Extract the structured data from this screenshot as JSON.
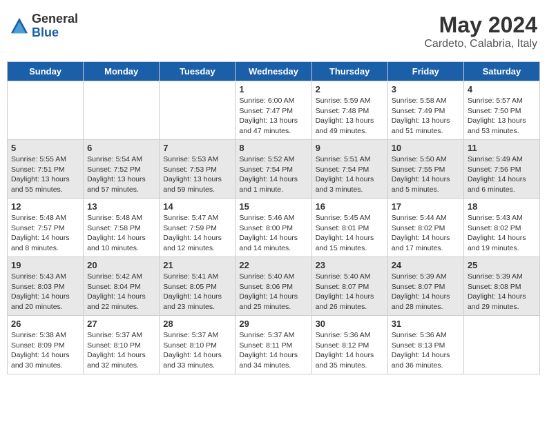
{
  "header": {
    "logo_general": "General",
    "logo_blue": "Blue",
    "title": "May 2024",
    "subtitle": "Cardeto, Calabria, Italy"
  },
  "days_of_week": [
    "Sunday",
    "Monday",
    "Tuesday",
    "Wednesday",
    "Thursday",
    "Friday",
    "Saturday"
  ],
  "weeks": [
    {
      "shade": false,
      "days": [
        {
          "num": "",
          "info": ""
        },
        {
          "num": "",
          "info": ""
        },
        {
          "num": "",
          "info": ""
        },
        {
          "num": "1",
          "info": "Sunrise: 6:00 AM\nSunset: 7:47 PM\nDaylight: 13 hours\nand 47 minutes."
        },
        {
          "num": "2",
          "info": "Sunrise: 5:59 AM\nSunset: 7:48 PM\nDaylight: 13 hours\nand 49 minutes."
        },
        {
          "num": "3",
          "info": "Sunrise: 5:58 AM\nSunset: 7:49 PM\nDaylight: 13 hours\nand 51 minutes."
        },
        {
          "num": "4",
          "info": "Sunrise: 5:57 AM\nSunset: 7:50 PM\nDaylight: 13 hours\nand 53 minutes."
        }
      ]
    },
    {
      "shade": true,
      "days": [
        {
          "num": "5",
          "info": "Sunrise: 5:55 AM\nSunset: 7:51 PM\nDaylight: 13 hours\nand 55 minutes."
        },
        {
          "num": "6",
          "info": "Sunrise: 5:54 AM\nSunset: 7:52 PM\nDaylight: 13 hours\nand 57 minutes."
        },
        {
          "num": "7",
          "info": "Sunrise: 5:53 AM\nSunset: 7:53 PM\nDaylight: 13 hours\nand 59 minutes."
        },
        {
          "num": "8",
          "info": "Sunrise: 5:52 AM\nSunset: 7:54 PM\nDaylight: 14 hours\nand 1 minute."
        },
        {
          "num": "9",
          "info": "Sunrise: 5:51 AM\nSunset: 7:54 PM\nDaylight: 14 hours\nand 3 minutes."
        },
        {
          "num": "10",
          "info": "Sunrise: 5:50 AM\nSunset: 7:55 PM\nDaylight: 14 hours\nand 5 minutes."
        },
        {
          "num": "11",
          "info": "Sunrise: 5:49 AM\nSunset: 7:56 PM\nDaylight: 14 hours\nand 6 minutes."
        }
      ]
    },
    {
      "shade": false,
      "days": [
        {
          "num": "12",
          "info": "Sunrise: 5:48 AM\nSunset: 7:57 PM\nDaylight: 14 hours\nand 8 minutes."
        },
        {
          "num": "13",
          "info": "Sunrise: 5:48 AM\nSunset: 7:58 PM\nDaylight: 14 hours\nand 10 minutes."
        },
        {
          "num": "14",
          "info": "Sunrise: 5:47 AM\nSunset: 7:59 PM\nDaylight: 14 hours\nand 12 minutes."
        },
        {
          "num": "15",
          "info": "Sunrise: 5:46 AM\nSunset: 8:00 PM\nDaylight: 14 hours\nand 14 minutes."
        },
        {
          "num": "16",
          "info": "Sunrise: 5:45 AM\nSunset: 8:01 PM\nDaylight: 14 hours\nand 15 minutes."
        },
        {
          "num": "17",
          "info": "Sunrise: 5:44 AM\nSunset: 8:02 PM\nDaylight: 14 hours\nand 17 minutes."
        },
        {
          "num": "18",
          "info": "Sunrise: 5:43 AM\nSunset: 8:02 PM\nDaylight: 14 hours\nand 19 minutes."
        }
      ]
    },
    {
      "shade": true,
      "days": [
        {
          "num": "19",
          "info": "Sunrise: 5:43 AM\nSunset: 8:03 PM\nDaylight: 14 hours\nand 20 minutes."
        },
        {
          "num": "20",
          "info": "Sunrise: 5:42 AM\nSunset: 8:04 PM\nDaylight: 14 hours\nand 22 minutes."
        },
        {
          "num": "21",
          "info": "Sunrise: 5:41 AM\nSunset: 8:05 PM\nDaylight: 14 hours\nand 23 minutes."
        },
        {
          "num": "22",
          "info": "Sunrise: 5:40 AM\nSunset: 8:06 PM\nDaylight: 14 hours\nand 25 minutes."
        },
        {
          "num": "23",
          "info": "Sunrise: 5:40 AM\nSunset: 8:07 PM\nDaylight: 14 hours\nand 26 minutes."
        },
        {
          "num": "24",
          "info": "Sunrise: 5:39 AM\nSunset: 8:07 PM\nDaylight: 14 hours\nand 28 minutes."
        },
        {
          "num": "25",
          "info": "Sunrise: 5:39 AM\nSunset: 8:08 PM\nDaylight: 14 hours\nand 29 minutes."
        }
      ]
    },
    {
      "shade": false,
      "days": [
        {
          "num": "26",
          "info": "Sunrise: 5:38 AM\nSunset: 8:09 PM\nDaylight: 14 hours\nand 30 minutes."
        },
        {
          "num": "27",
          "info": "Sunrise: 5:37 AM\nSunset: 8:10 PM\nDaylight: 14 hours\nand 32 minutes."
        },
        {
          "num": "28",
          "info": "Sunrise: 5:37 AM\nSunset: 8:10 PM\nDaylight: 14 hours\nand 33 minutes."
        },
        {
          "num": "29",
          "info": "Sunrise: 5:37 AM\nSunset: 8:11 PM\nDaylight: 14 hours\nand 34 minutes."
        },
        {
          "num": "30",
          "info": "Sunrise: 5:36 AM\nSunset: 8:12 PM\nDaylight: 14 hours\nand 35 minutes."
        },
        {
          "num": "31",
          "info": "Sunrise: 5:36 AM\nSunset: 8:13 PM\nDaylight: 14 hours\nand 36 minutes."
        },
        {
          "num": "",
          "info": ""
        }
      ]
    }
  ]
}
